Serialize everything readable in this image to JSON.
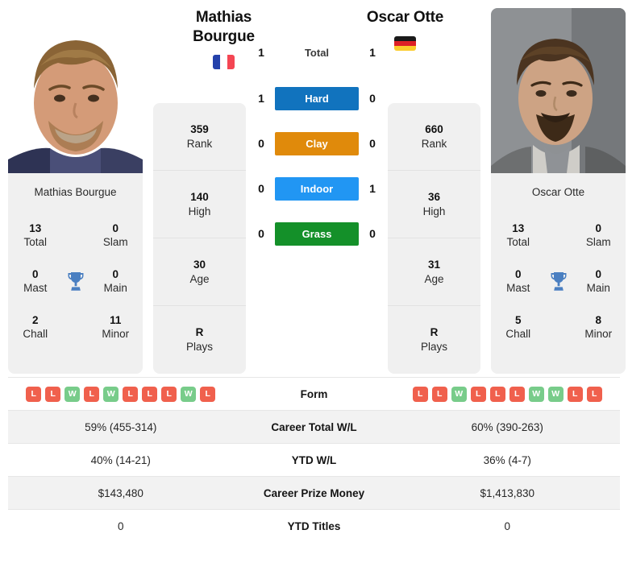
{
  "players": {
    "left": {
      "name": "Mathias Bourgue",
      "name_line1": "Mathias",
      "name_line2": "Bourgue",
      "country_flag": "france-flag",
      "card_name": "Mathias Bourgue",
      "rank": "359",
      "rank_label": "Rank",
      "high": "140",
      "high_label": "High",
      "age": "30",
      "age_label": "Age",
      "plays": "R",
      "plays_label": "Plays",
      "titles": {
        "total": "13",
        "total_label": "Total",
        "slam": "0",
        "slam_label": "Slam",
        "mast": "0",
        "mast_label": "Mast",
        "main": "0",
        "main_label": "Main",
        "chall": "2",
        "chall_label": "Chall",
        "minor": "11",
        "minor_label": "Minor"
      },
      "form": [
        "L",
        "L",
        "W",
        "L",
        "W",
        "L",
        "L",
        "L",
        "W",
        "L"
      ],
      "career_total_wl": "59% (455-314)",
      "ytd_wl": "40% (14-21)",
      "career_prize_money": "$143,480",
      "ytd_titles": "0"
    },
    "right": {
      "name": "Oscar Otte",
      "name_line1": "Oscar Otte",
      "name_line2": "",
      "country_flag": "germany-flag",
      "card_name": "Oscar Otte",
      "rank": "660",
      "rank_label": "Rank",
      "high": "36",
      "high_label": "High",
      "age": "31",
      "age_label": "Age",
      "plays": "R",
      "plays_label": "Plays",
      "titles": {
        "total": "13",
        "total_label": "Total",
        "slam": "0",
        "slam_label": "Slam",
        "mast": "0",
        "mast_label": "Mast",
        "main": "0",
        "main_label": "Main",
        "chall": "5",
        "chall_label": "Chall",
        "minor": "8",
        "minor_label": "Minor"
      },
      "form": [
        "L",
        "L",
        "W",
        "L",
        "L",
        "L",
        "W",
        "W",
        "L",
        "L"
      ],
      "career_total_wl": "60% (390-263)",
      "ytd_wl": "36% (4-7)",
      "career_prize_money": "$1,413,830",
      "ytd_titles": "0"
    }
  },
  "h2h": {
    "rows": [
      {
        "label": "Total",
        "left": "1",
        "right": "1",
        "badge": false,
        "color": ""
      },
      {
        "label": "Hard",
        "left": "1",
        "right": "0",
        "badge": true,
        "color": "#1173be"
      },
      {
        "label": "Clay",
        "left": "0",
        "right": "0",
        "badge": true,
        "color": "#e08a0b"
      },
      {
        "label": "Indoor",
        "left": "0",
        "right": "1",
        "badge": true,
        "color": "#2196f3"
      },
      {
        "label": "Grass",
        "left": "0",
        "right": "0",
        "badge": true,
        "color": "#149029"
      }
    ]
  },
  "table": {
    "rows": [
      {
        "label": "Form",
        "type": "form"
      },
      {
        "label": "Career Total W/L",
        "type": "text",
        "key": "career_total_wl"
      },
      {
        "label": "YTD W/L",
        "type": "text",
        "key": "ytd_wl"
      },
      {
        "label": "Career Prize Money",
        "type": "text",
        "key": "career_prize_money"
      },
      {
        "label": "YTD Titles",
        "type": "text",
        "key": "ytd_titles"
      }
    ]
  },
  "colors": {
    "win": "#78cc8a",
    "loss": "#f0604d",
    "card_bg": "#f0f0f0",
    "row_alt": "#f2f2f2",
    "trophy": "#4a7fc1"
  }
}
